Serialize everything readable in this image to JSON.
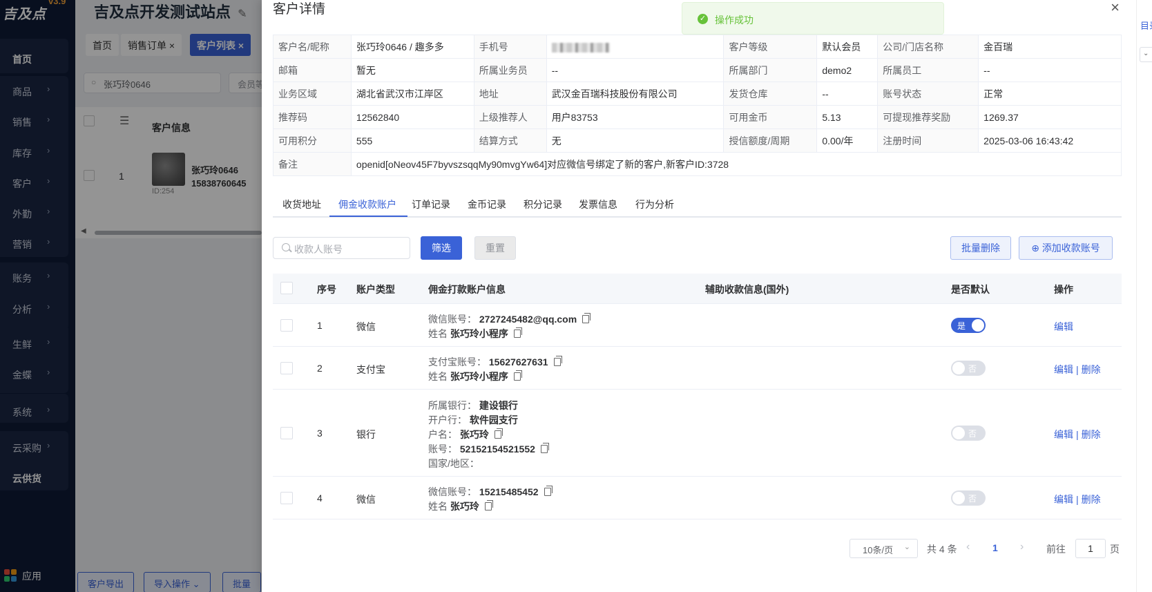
{
  "sidebar": {
    "logo_text": "吉及点",
    "version": "v3.9",
    "items": [
      {
        "label": "首页",
        "chevron": false,
        "bold": true
      },
      {
        "label": "商品",
        "chevron": true,
        "bold": false
      },
      {
        "label": "销售",
        "chevron": true,
        "bold": false
      },
      {
        "label": "库存",
        "chevron": true,
        "bold": false
      },
      {
        "label": "客户",
        "chevron": true,
        "bold": false
      },
      {
        "label": "外勤",
        "chevron": true,
        "bold": false
      },
      {
        "label": "营销",
        "chevron": true,
        "bold": false
      },
      {
        "label": "账务",
        "chevron": true,
        "bold": false
      },
      {
        "label": "分析",
        "chevron": true,
        "bold": false
      },
      {
        "label": "生鲜",
        "chevron": true,
        "bold": false
      },
      {
        "label": "金蝶",
        "chevron": true,
        "bold": false
      },
      {
        "label": "系统",
        "chevron": true,
        "bold": false
      },
      {
        "label": "云采购",
        "chevron": true,
        "bold": false
      },
      {
        "label": "云供货",
        "chevron": false,
        "bold": true
      }
    ],
    "app_label": "应用"
  },
  "background": {
    "site_title": "吉及点开发测试站点",
    "tabs": [
      {
        "label": "首页",
        "closable": false,
        "active": false
      },
      {
        "label": "销售订单",
        "closable": true,
        "active": false
      },
      {
        "label": "客户列表",
        "closable": true,
        "active": true
      }
    ],
    "search_value": "张巧玲0646",
    "member_placeholder": "会员等",
    "col_customer_info": "客户信息",
    "row_index": "1",
    "row_name": "张巧玲0646",
    "row_phone": "15838760645",
    "row_id": "ID:254",
    "bottom_buttons": [
      "客户导出",
      "导入操作",
      "批量"
    ]
  },
  "drawer": {
    "title": "客户详情",
    "close_icon": "×",
    "toast": "操作成功",
    "info_rows": [
      [
        {
          "k": "客户名/昵称",
          "v": "张巧玲0646 / 趣多多"
        },
        {
          "k": "手机号",
          "v": "",
          "blurred": true
        },
        {
          "k": "客户等级",
          "v": "默认会员"
        },
        {
          "k": "公司/门店名称",
          "v": "金百瑞"
        }
      ],
      [
        {
          "k": "邮箱",
          "v": "暂无"
        },
        {
          "k": "所属业务员",
          "v": "--"
        },
        {
          "k": "所属部门",
          "v": "demo2"
        },
        {
          "k": "所属员工",
          "v": "--"
        }
      ],
      [
        {
          "k": "业务区域",
          "v": "湖北省武汉市江岸区"
        },
        {
          "k": "地址",
          "v": "武汉金百瑞科技股份有限公司"
        },
        {
          "k": "发货仓库",
          "v": "--"
        },
        {
          "k": "账号状态",
          "v": "正常"
        }
      ],
      [
        {
          "k": "推荐码",
          "v": "12562840"
        },
        {
          "k": "上级推荐人",
          "v": "用户83753"
        },
        {
          "k": "可用金币",
          "v": "5.13"
        },
        {
          "k": "可提现推荐奖励",
          "v": "1269.37"
        }
      ],
      [
        {
          "k": "可用积分",
          "v": "555"
        },
        {
          "k": "结算方式",
          "v": "无"
        },
        {
          "k": "授信额度/周期",
          "v": "0.00/年"
        },
        {
          "k": "注册时间",
          "v": "2025-03-06 16:43:42"
        }
      ]
    ],
    "remark_label": "备注",
    "remark_value": "openid[oNeov45F7byvszsqqMy90mvgYw64]对应微信号绑定了新的客户,新客户ID:3728",
    "tabs": [
      "收货地址",
      "佣金收款账户",
      "订单记录",
      "金币记录",
      "积分记录",
      "发票信息",
      "行为分析"
    ],
    "active_tab": "佣金收款账户",
    "filter": {
      "placeholder": "收款人账号",
      "search_btn": "筛选",
      "reset_btn": "重置",
      "batch_delete_btn": "批量删除",
      "add_btn": "添加收款账号"
    },
    "columns": [
      "序号",
      "账户类型",
      "佣金打款账户信息",
      "辅助收款信息(国外)",
      "是否默认",
      "操作"
    ],
    "rows": [
      {
        "index": "1",
        "type": "微信",
        "lines": [
          {
            "label": "微信账号：",
            "value": "2727245482@qq.com",
            "copy": true
          },
          {
            "label": "姓名",
            "value": "张巧玲小程序",
            "copy": true
          }
        ],
        "default": true,
        "default_on": "是",
        "default_off": "否",
        "actions": [
          "编辑"
        ]
      },
      {
        "index": "2",
        "type": "支付宝",
        "lines": [
          {
            "label": "支付宝账号：",
            "value": "15627627631",
            "copy": true
          },
          {
            "label": "姓名",
            "value": "张巧玲小程序",
            "copy": true
          }
        ],
        "default": false,
        "default_on": "是",
        "default_off": "否",
        "actions": [
          "编辑",
          "删除"
        ]
      },
      {
        "index": "3",
        "type": "银行",
        "lines": [
          {
            "label": "所属银行：",
            "value": "建设银行",
            "copy": false
          },
          {
            "label": "开户行：",
            "value": "软件园支行",
            "copy": false
          },
          {
            "label": "户名：",
            "value": "张巧玲",
            "copy": true
          },
          {
            "label": "账号：",
            "value": "52152154521552",
            "copy": true
          },
          {
            "label": "国家/地区：",
            "value": "",
            "copy": false
          }
        ],
        "default": false,
        "default_on": "是",
        "default_off": "否",
        "actions": [
          "编辑",
          "删除"
        ]
      },
      {
        "index": "4",
        "type": "微信",
        "lines": [
          {
            "label": "微信账号：",
            "value": "15215485452",
            "copy": true
          },
          {
            "label": "姓名",
            "value": "张巧玲",
            "copy": true
          }
        ],
        "default": false,
        "default_on": "是",
        "default_off": "否",
        "actions": [
          "编辑",
          "删除"
        ]
      }
    ],
    "pagination": {
      "page_size": "10条/页",
      "total": "共 4 条",
      "current_page": "1",
      "goto_prefix": "前往",
      "goto_value": "1",
      "goto_suffix": "页"
    }
  },
  "right_strip": {
    "link_text": "目录"
  },
  "colors": {
    "primary": "#3a62d7",
    "sidebar_bg": "#0f1b36",
    "success": "#67c23a"
  }
}
